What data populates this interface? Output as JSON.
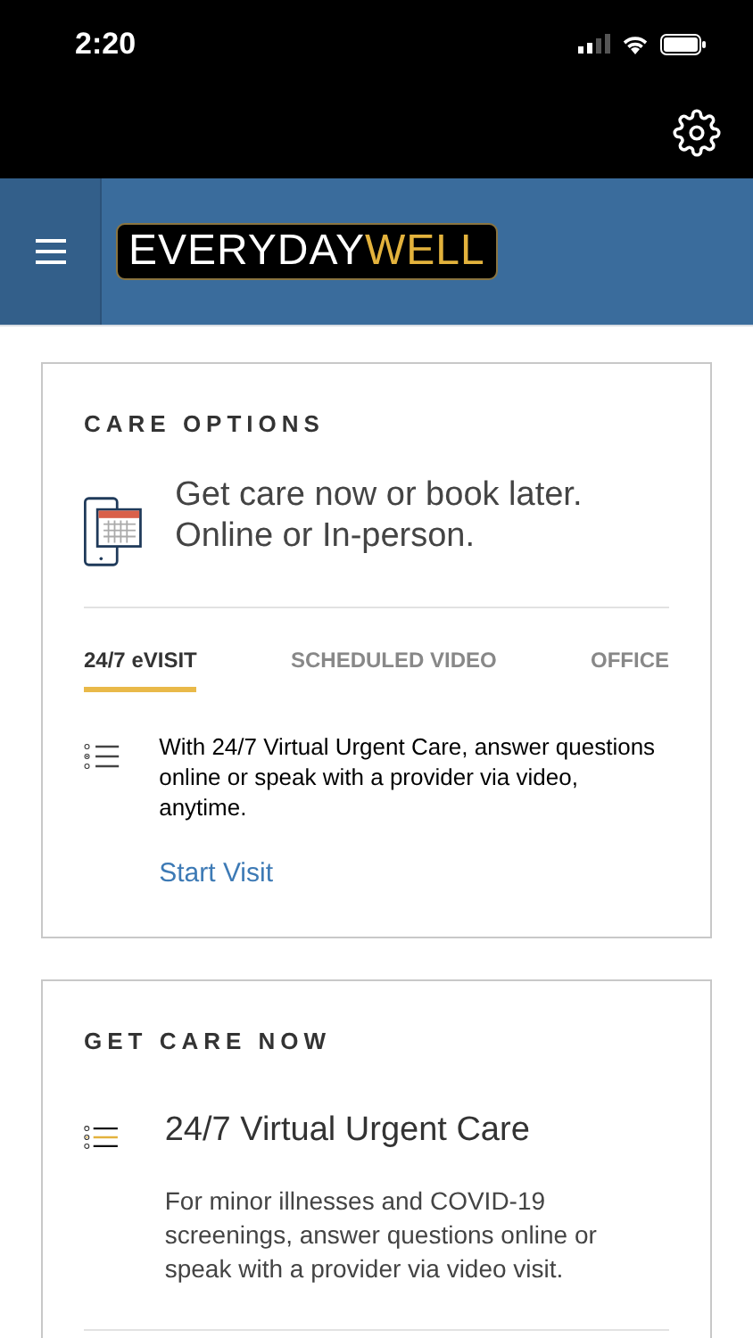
{
  "status_bar": {
    "time": "2:20"
  },
  "header": {
    "logo": {
      "first": "EVERYDAY",
      "second": "WELL"
    }
  },
  "care_options": {
    "title": "CARE OPTIONS",
    "headline": "Get care now or book later. Online or In-person.",
    "tabs": [
      {
        "label": "24/7 eVISIT",
        "selected": true
      },
      {
        "label": "SCHEDULED VIDEO",
        "selected": false
      },
      {
        "label": "OFFICE",
        "selected": false
      }
    ],
    "description": "With 24/7 Virtual Urgent Care, answer questions online or speak with a provider via video, anytime.",
    "link": "Start Visit"
  },
  "get_care_now": {
    "title": "GET CARE NOW",
    "heading": "24/7 Virtual Urgent Care",
    "description": "For minor illnesses and COVID-19 screenings, answer questions online or speak with a provider via video visit."
  }
}
